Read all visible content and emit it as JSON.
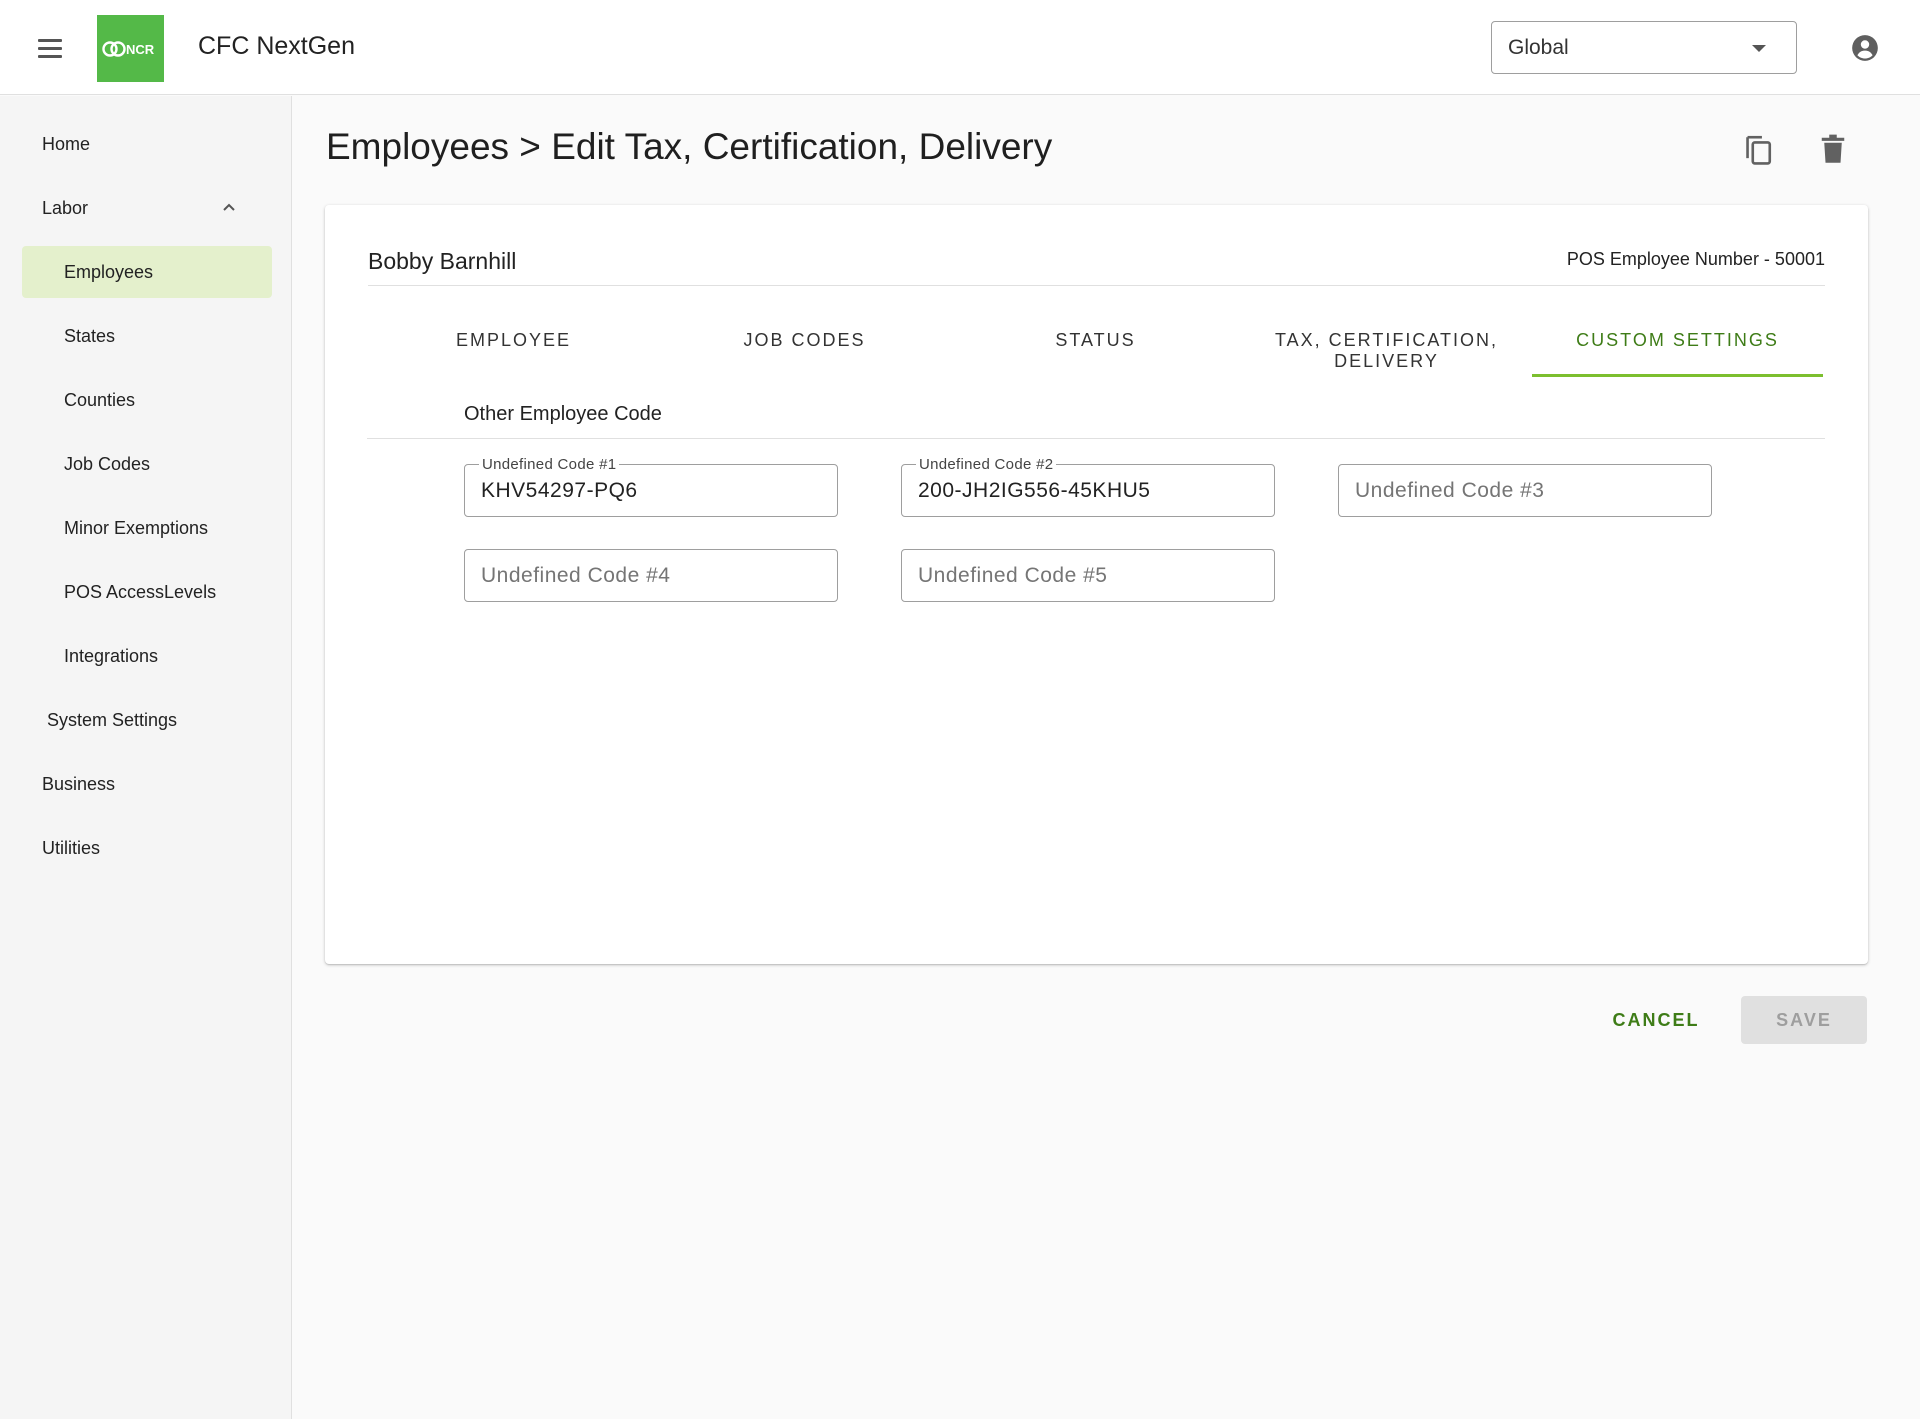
{
  "app": {
    "title": "CFC NextGen",
    "logo_text": "NCR",
    "brand_color": "#54b948",
    "accent_color": "#3e7c17"
  },
  "header": {
    "scope_value": "Global",
    "menu_icon": "hamburger-menu-icon",
    "account_icon": "account-circle-icon"
  },
  "sidebar": {
    "items": [
      {
        "label": "Home"
      },
      {
        "label": "Labor",
        "expanded": true
      },
      {
        "label": "Employees",
        "active": true
      },
      {
        "label": "States"
      },
      {
        "label": "Counties"
      },
      {
        "label": "Job Codes"
      },
      {
        "label": "Minor Exemptions"
      },
      {
        "label": "POS AccessLevels"
      },
      {
        "label": "Integrations"
      },
      {
        "label": "System Settings"
      },
      {
        "label": "Business"
      },
      {
        "label": "Utilities"
      }
    ]
  },
  "page": {
    "title": "Employees > Edit Tax, Certification, Delivery",
    "actions": [
      "copy-icon",
      "delete-icon"
    ]
  },
  "employee": {
    "name": "Bobby Barnhill",
    "pos_number": "POS Employee Number - 50001"
  },
  "tabs": [
    {
      "label": "EMPLOYEE"
    },
    {
      "label": "JOB CODES"
    },
    {
      "label": "STATUS"
    },
    {
      "label": "TAX, CERTIFICATION, DELIVERY"
    },
    {
      "label": "CUSTOM SETTINGS",
      "active": true
    }
  ],
  "section": {
    "title": "Other Employee Code"
  },
  "fields": [
    {
      "label": "Undefined Code #1",
      "value": "KHV54297-PQ6",
      "placeholder": ""
    },
    {
      "label": "Undefined Code #2",
      "value": "200-JH2IG556-45KHU5",
      "placeholder": ""
    },
    {
      "label": "",
      "value": "",
      "placeholder": "Undefined Code #3"
    },
    {
      "label": "",
      "value": "",
      "placeholder": "Undefined Code #4"
    },
    {
      "label": "",
      "value": "",
      "placeholder": "Undefined Code #5"
    }
  ],
  "footer": {
    "cancel_label": "CANCEL",
    "save_label": "SAVE"
  }
}
